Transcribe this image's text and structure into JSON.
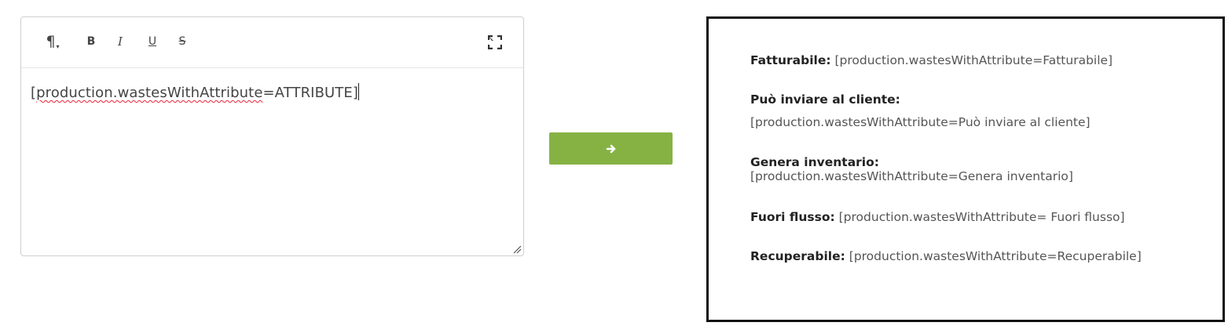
{
  "editor": {
    "toolbar": {
      "paragraph_icon": "pilcrow-icon",
      "bold_label": "B",
      "italic_label": "I",
      "underline_label": "U",
      "strike_label": "S",
      "fullscreen_icon": "expand-icon"
    },
    "content": {
      "open_bracket": "[",
      "misspelled": "production.wastesWithAttribute",
      "rest": "=ATTRIBUTE]"
    }
  },
  "convert_button": {
    "icon": "arrow-right-icon",
    "color": "#86b244"
  },
  "preview": {
    "rows": [
      {
        "label": "Fatturabile:",
        "value": "[production.wastesWithAttribute=Fatturabile]"
      },
      {
        "label": "Può inviare al cliente:",
        "value": "[production.wastesWithAttribute=Può inviare al cliente]"
      },
      {
        "label": "Genera inventario:",
        "value": "[production.wastesWithAttribute=Genera inventario]"
      },
      {
        "label": "Fuori flusso:",
        "value": "[production.wastesWithAttribute= Fuori flusso]"
      },
      {
        "label": "Recuperabile:",
        "value": "[production.wastesWithAttribute=Recuperabile]"
      }
    ]
  }
}
